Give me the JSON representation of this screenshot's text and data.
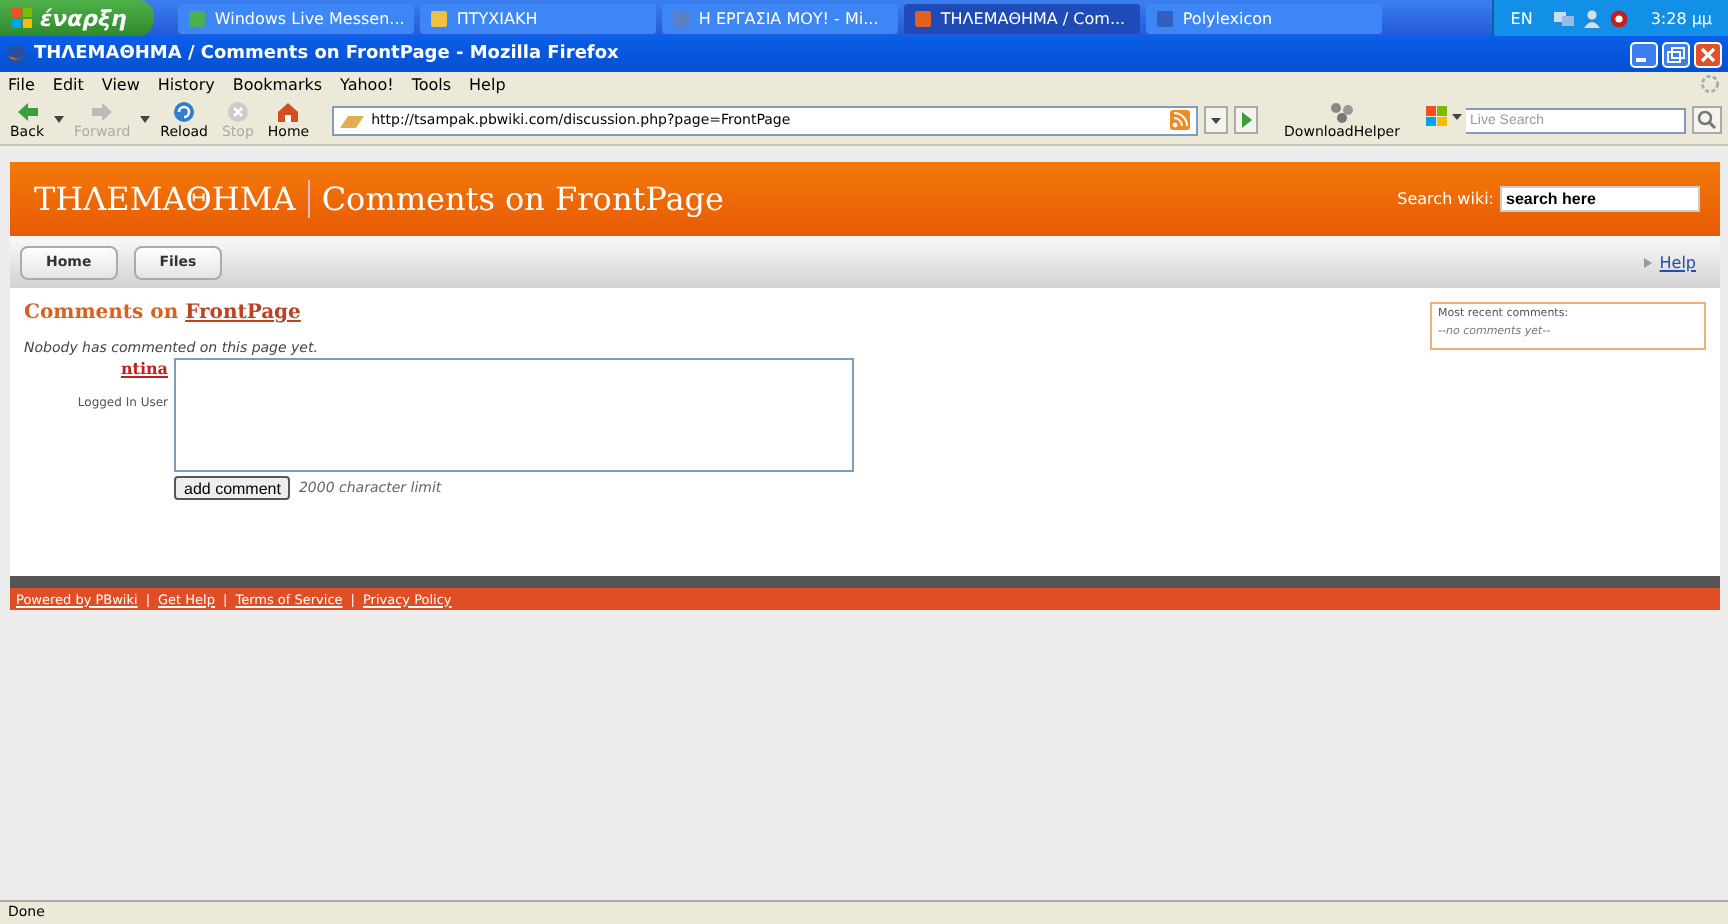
{
  "taskbar": {
    "start": "έναρξη",
    "tasks": [
      {
        "label": "Windows Live Messen...",
        "selected": false
      },
      {
        "label": "ΠΤΥΧΙΑΚΗ",
        "selected": false
      },
      {
        "label": "Η ΕΡΓΑΣΙΑ ΜΟΥ! - Mi...",
        "selected": false
      },
      {
        "label": "ΤΗΛΕΜΑΘΗΜΑ / Com...",
        "selected": true
      },
      {
        "label": "Polylexicon",
        "selected": false
      }
    ],
    "language": "EN",
    "clock": "3:28 μμ"
  },
  "window": {
    "title": "ΤΗΛΕΜΑΘΗΜΑ / Comments on FrontPage - Mozilla Firefox"
  },
  "menu": [
    "File",
    "Edit",
    "View",
    "History",
    "Bookmarks",
    "Yahoo!",
    "Tools",
    "Help"
  ],
  "toolbar": {
    "buttons": [
      {
        "label": "Back",
        "disabled": false
      },
      {
        "label": "Forward",
        "disabled": true
      },
      {
        "label": "Reload",
        "disabled": false
      },
      {
        "label": "Stop",
        "disabled": true
      },
      {
        "label": "Home",
        "disabled": false
      }
    ],
    "url": "http://tsampak.pbwiki.com/discussion.php?page=FrontPage",
    "download_helper": "DownloadHelper",
    "search_placeholder": "Live Search"
  },
  "page": {
    "site": "ΤΗΛΕΜΑΘΗΜΑ",
    "title": "Comments on FrontPage",
    "search_label": "Search wiki:",
    "search_value": "search here",
    "tabs": [
      "Home",
      "Files"
    ],
    "help": "Help",
    "heading": "Comments on ",
    "heading_link": "FrontPage",
    "empty_note": "Nobody has commented on this page yet.",
    "user": "ntina",
    "user_role": "Logged In User",
    "submit": "add comment",
    "limit": "2000 character limit",
    "recent_title": "Most recent comments:",
    "recent_empty": "--no comments yet--",
    "footer": [
      {
        "kind": "link",
        "text": "Powered by PBwiki"
      },
      {
        "kind": "separator",
        "text": "|"
      },
      {
        "kind": "link",
        "text": "Get Help"
      },
      {
        "kind": "separator",
        "text": "|"
      },
      {
        "kind": "link",
        "text": "Terms of Service"
      },
      {
        "kind": "separator",
        "text": "|"
      },
      {
        "kind": "link",
        "text": "Privacy Policy"
      }
    ]
  },
  "status_bar": "Done"
}
